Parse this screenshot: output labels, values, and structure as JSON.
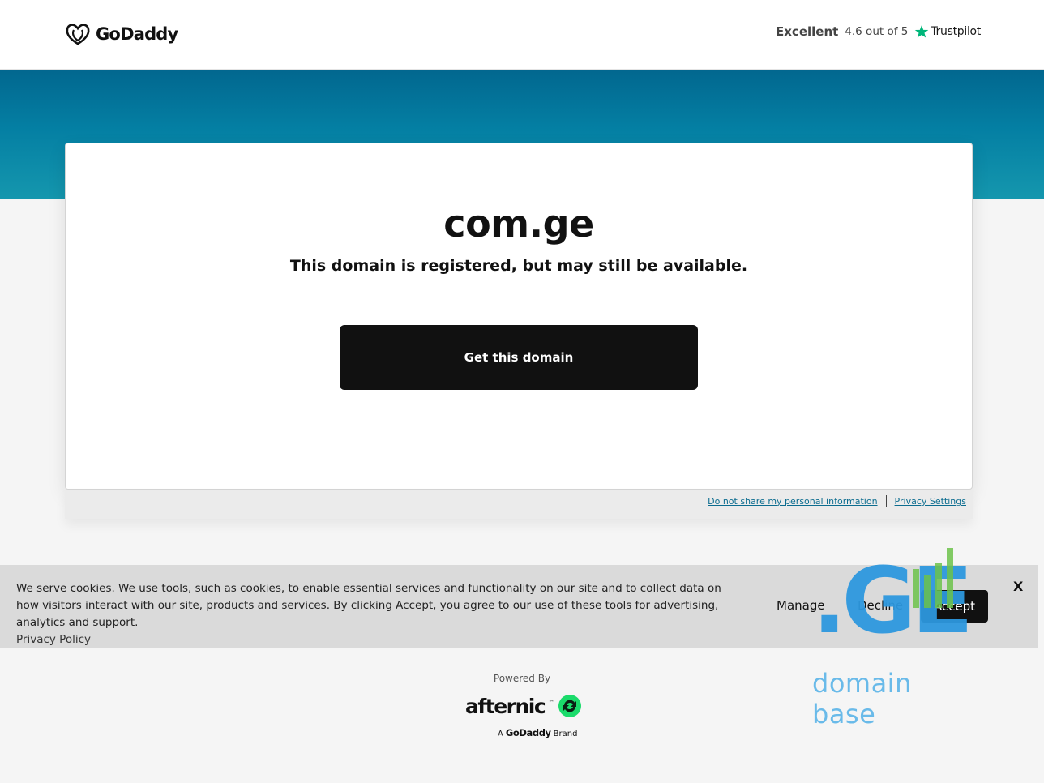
{
  "header": {
    "logo_text": "GoDaddy",
    "trustpilot": {
      "rating_word": "Excellent",
      "score_text": "4.6 out of 5",
      "brand": "Trustpilot",
      "star_color": "#00b67a"
    }
  },
  "card": {
    "domain": "com.ge",
    "subtitle": "This domain is registered, but may still be available.",
    "cta_label": "Get this domain"
  },
  "footer_links": {
    "do_not_share": "Do not share my personal information",
    "privacy_settings": "Privacy Settings"
  },
  "cookie_banner": {
    "text": "We serve cookies. We use tools, such as cookies, to enable essential services and functionality on our site and to collect data on how visitors interact with our site, products and services. By clicking Accept, you agree to our use of these tools for advertising, analytics and support.",
    "privacy_link": "Privacy Policy",
    "manage_label": "Manage",
    "decline_label": "Decline",
    "accept_label": "Accept",
    "close_label": "X"
  },
  "watermark": {
    "logo_text": ".GE",
    "tagline": "domain base",
    "bar_color": "#6cc24a"
  },
  "powered_by": {
    "label": "Powered By",
    "brand": "afternic",
    "tm": "™",
    "parent_prefix": "A",
    "parent_name": "GoDaddy",
    "parent_suffix": "Brand"
  }
}
